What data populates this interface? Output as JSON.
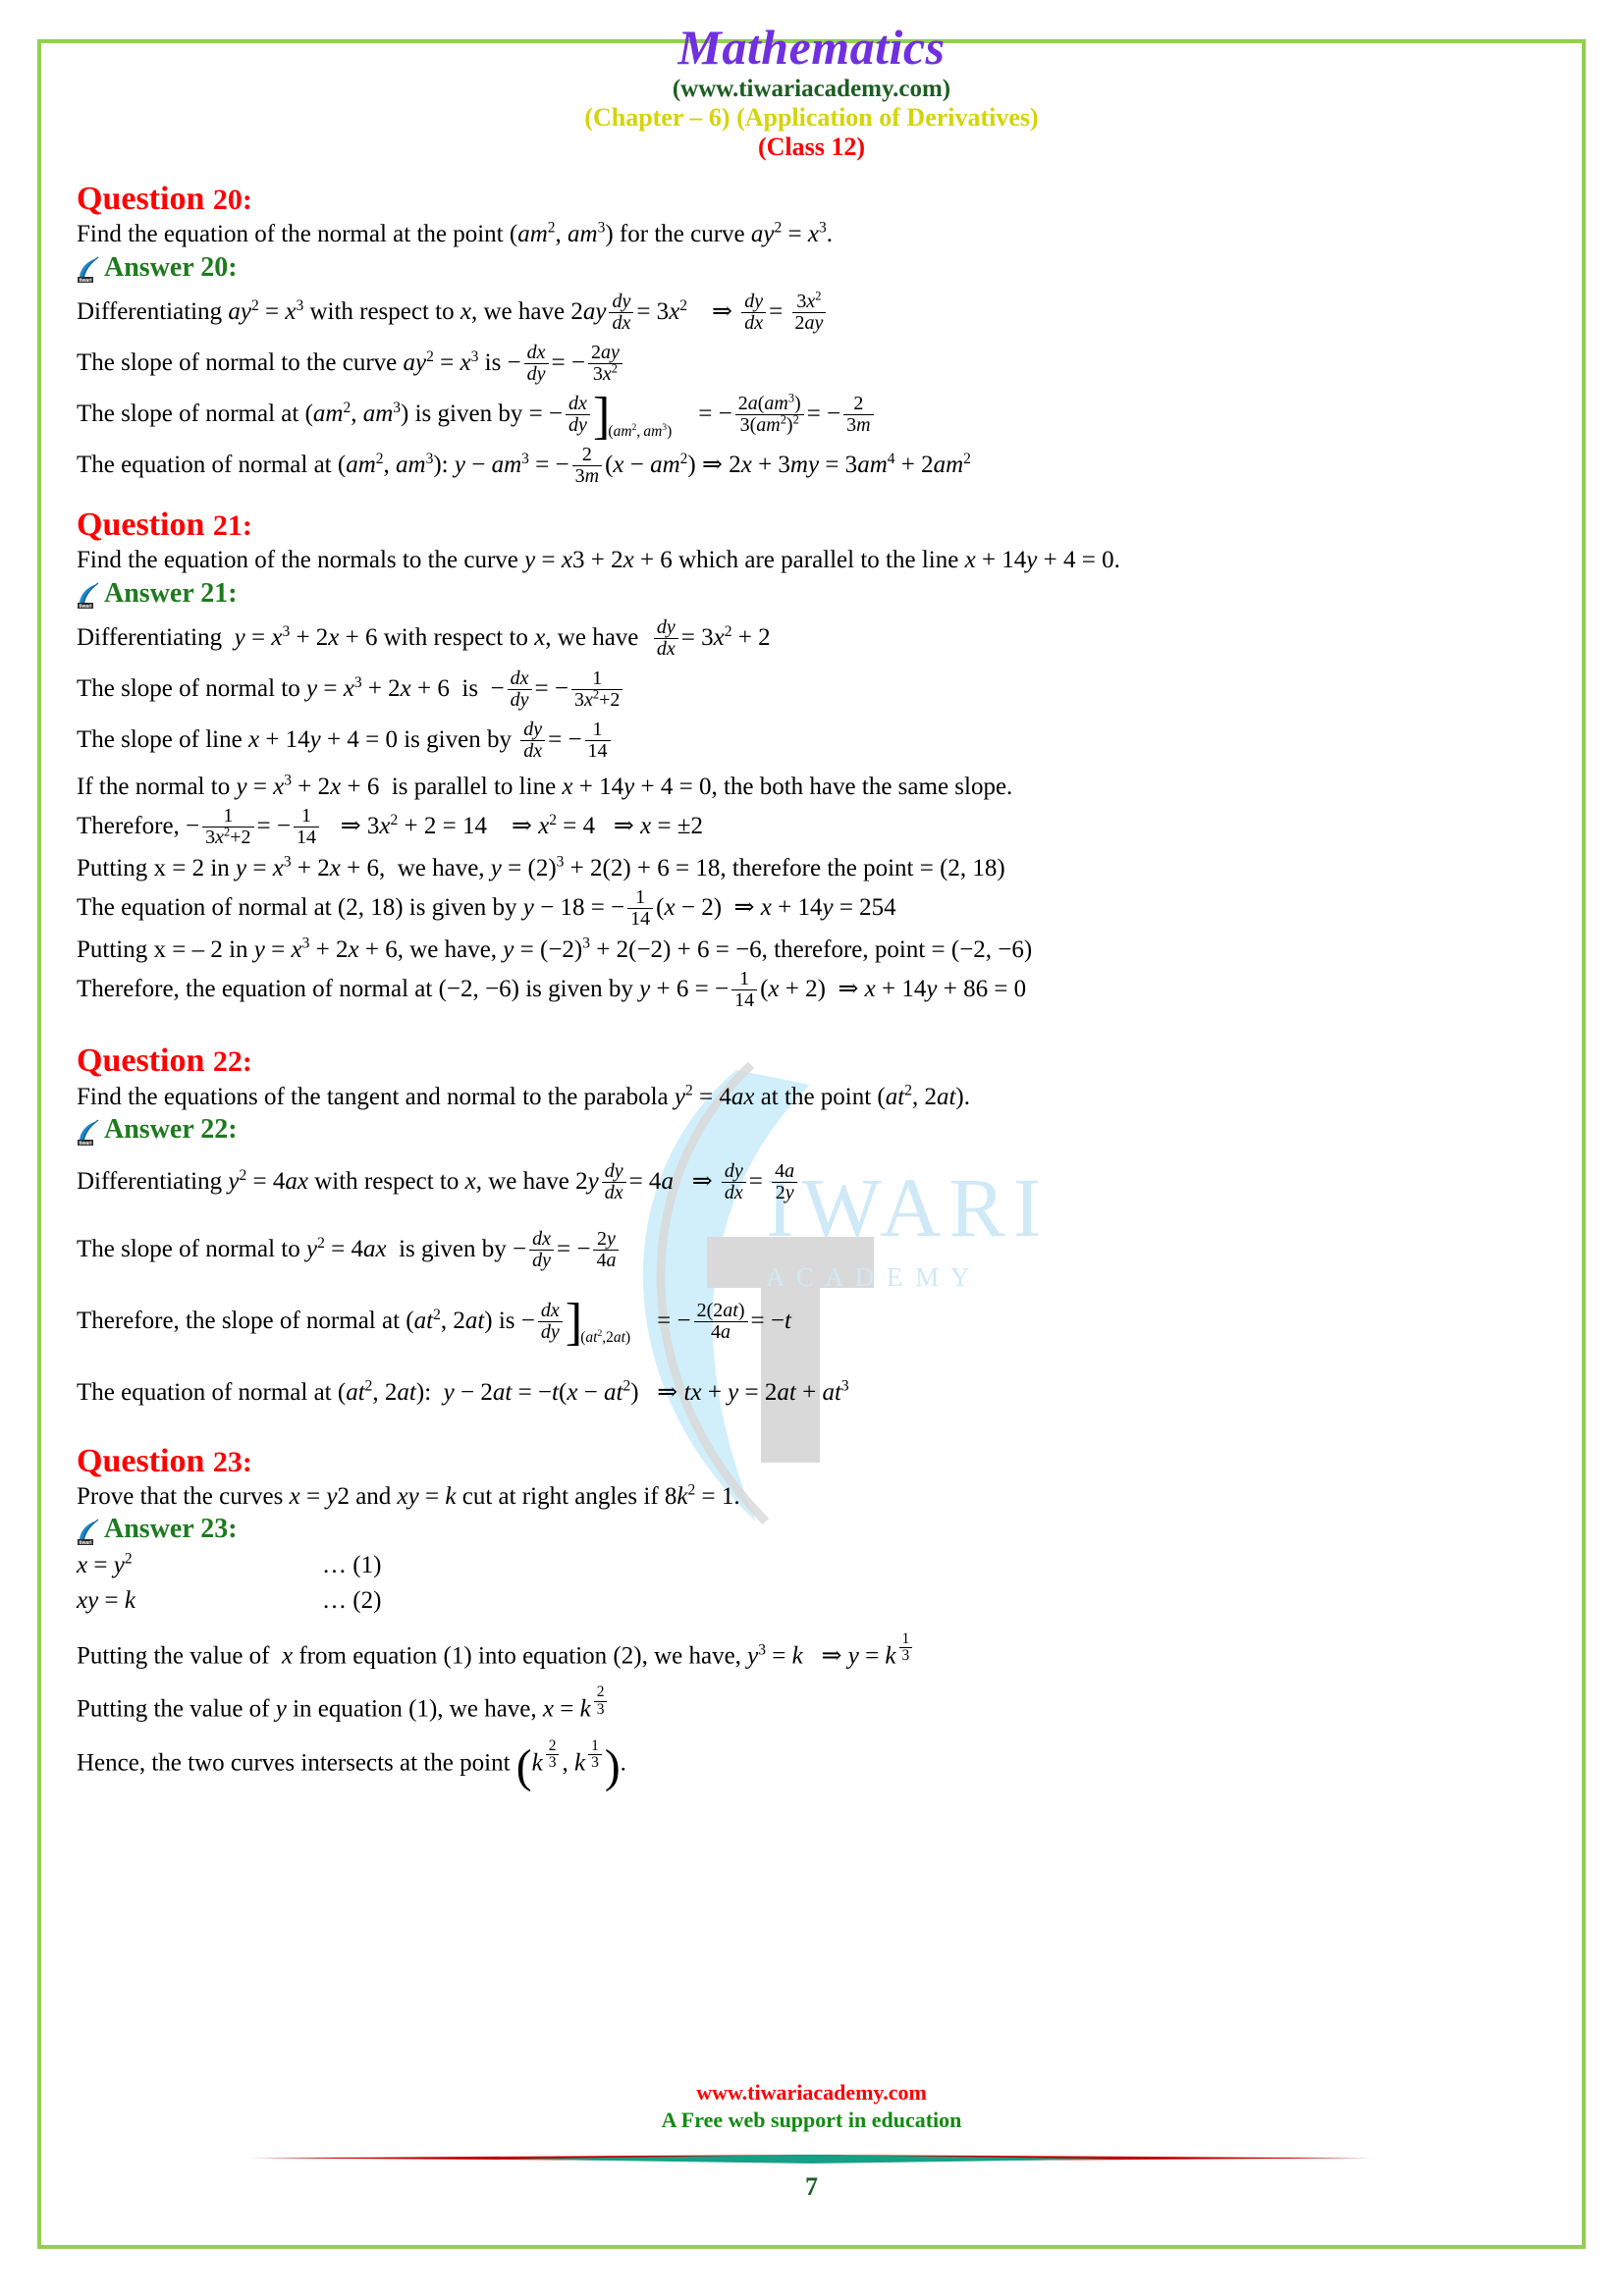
{
  "header": {
    "title": "Mathematics",
    "site": "(www.tiwariacademy.com)",
    "chapter": "(Chapter – 6) (Application of Derivatives)",
    "class": "(Class 12)"
  },
  "watermark": {
    "brand": "IWARI",
    "sub": "A C A D E M Y",
    "color": "#cfe9f7"
  },
  "colors": {
    "title": "#7030e0",
    "site": "#1b5e20",
    "chapter": "#d4d40a",
    "class": "#ff0000",
    "question": "#ff0000",
    "answer": "#1e7a1e",
    "border": "#92d050",
    "footer_url": "#ff0000",
    "footer_tagline": "#128a12",
    "rule_red": "#c00000",
    "rule_green": "#16a085"
  },
  "icons": {
    "quill": "quill-logo-icon"
  },
  "questions": [
    {
      "id": "q20",
      "heading": "Question 20:",
      "heading_label": "Question",
      "heading_num": "20:",
      "prompt": "Find the equation of the normal at the point (am2, am3) for the curve ay2 = x3.",
      "answer_heading": "Answer 20:",
      "steps": [
        "Differentiating ay² = x³ with respect to x, we have 2ay dy/dx = 3x²  ⇒ dy/dx = 3x²/2ay",
        "The slope of normal to the curve ay² = x³ is − dx/dy = − 2ay/3x²",
        "The slope of normal at (am², am³) is given by = − dx/dy](am², am³) = − 2a(am³)/3(am²)² = − 2/3m",
        "The equation of normal at (am², am³): y − am³ = − 2/3m (x − am²) ⇒ 2x + 3my = 3am⁴ + 2am²"
      ]
    },
    {
      "id": "q21",
      "heading": "Question 21:",
      "heading_label": "Question",
      "heading_num": "21:",
      "prompt": "Find the equation of the normals to the curve y = x3 + 2x + 6 which are parallel to the line x + 14y + 4 = 0.",
      "answer_heading": "Answer 21:",
      "steps": [
        "Differentiating  y = x³ + 2x + 6 with respect to x, we have  dy/dx = 3x² + 2",
        "The slope of normal to y = x³ + 2x + 6  is − dx/dy = − 1/(3x²+2)",
        "The slope of line x + 14y + 4 = 0 is given by dy/dx = − 1/14",
        "If the normal to y = x³ + 2x + 6  is parallel to line x + 14y + 4 = 0, the both have the same slope.",
        "Therefore, − 1/(3x²+2) = − 1/14   ⇒ 3x² + 2 = 14   ⇒ x² = 4   ⇒ x = ±2",
        "Putting x = 2 in y = x³ + 2x + 6,  we have, y = (2)³ + 2(2) + 6 = 18, therefore the point = (2, 18)",
        "The equation of normal at (2, 18) is given by y − 18 = − 1/14 (x − 2)  ⇒ x + 14y = 254",
        "Putting x = – 2 in y = x³ + 2x + 6, we have, y = (−2)³ + 2(−2) + 6 = −6, therefore, point = (−2, −6)",
        "Therefore, the equation of normal at (−2, −6) is given by y + 6 = − 1/14 (x + 2) ⇒ x + 14y + 86 = 0"
      ]
    },
    {
      "id": "q22",
      "heading": "Question 22:",
      "heading_label": "Question",
      "heading_num": "22:",
      "prompt": "Find the equations of the tangent and normal to the parabola y2 = 4ax at the point (at2, 2at).",
      "answer_heading": "Answer 22:",
      "steps": [
        "Differentiating y² = 4ax with respect to x, we have 2y dy/dx = 4a  ⇒ dy/dx = 4a/2y",
        "The slope of normal to y² = 4ax  is given by − dx/dy = − 2y/4a",
        "Therefore, the slope of normal at (at², 2at) is − dx/dy](at²,2at) = − 2(2at)/4a = −t",
        "The equation of normal at (at², 2at):  y − 2at = −t(x − at²)   ⇒ tx + y = 2at + at³"
      ]
    },
    {
      "id": "q23",
      "heading": "Question 23:",
      "heading_label": "Question",
      "heading_num": "23:",
      "prompt": "Prove that the curves x = y2 and xy = k cut at right angles if 8k2 = 1.",
      "answer_heading": "Answer 23:",
      "steps": [
        "x = y²   … (1)",
        "xy = k   … (2)",
        "Putting the value of  x from equation (1) into equation (2), we have, y³ = k   ⇒ y = k^(1/3)",
        "Putting the value of y in equation (1), we have, x = k^(2/3)",
        "Hence, the two curves intersects at the point (k^(2/3), k^(1/3))."
      ],
      "eq_labels": [
        "… (1)",
        "… (2)"
      ]
    }
  ],
  "footer": {
    "url": "www.tiwariacademy.com",
    "tagline": "A Free web support in education",
    "page_number": "7"
  }
}
